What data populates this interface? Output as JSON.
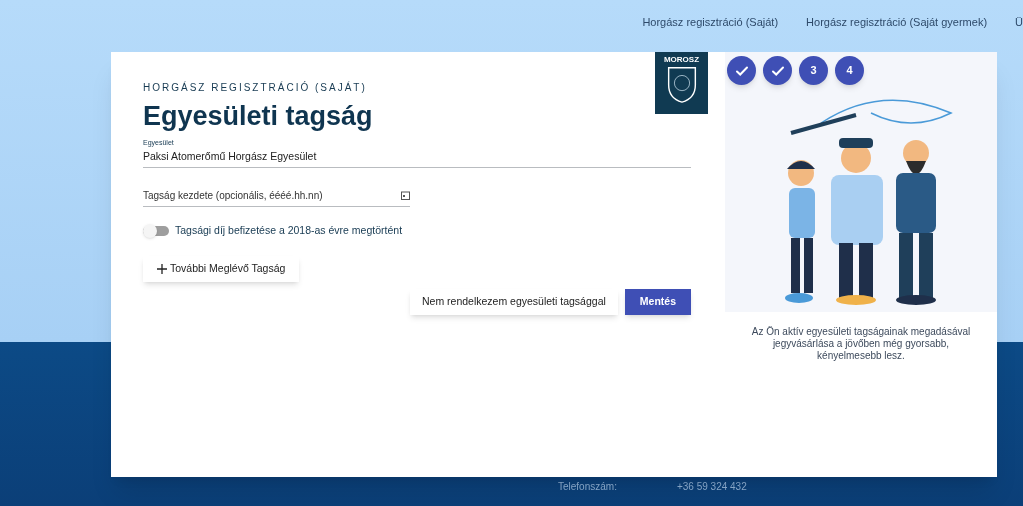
{
  "nav": {
    "items": [
      {
        "label": "Horgász regisztráció (Saját)"
      },
      {
        "label": "Horgász regisztráció (Saját gyermek)"
      },
      {
        "label": "Ü"
      }
    ]
  },
  "modal": {
    "logo": {
      "text": "MOROSZ"
    },
    "eyebrow": "HORGÁSZ REGISZTRÁCIÓ (SAJÁT)",
    "title": "Egyesületi tagság",
    "association_field": {
      "label": "Egyesület",
      "value": "Paksi Atomerőmű Horgász Egyesület"
    },
    "start_date_field": {
      "placeholder": "Tagság kezdete (opcionális, éééé.hh.nn)"
    },
    "fee_toggle": {
      "label": "Tagsági díj befizetése a 2018-as évre megtörtént",
      "on": false
    },
    "add_button": "További Meglévő Tagság",
    "secondary_button": "Nem rendelkezem egyesületi tagsággal",
    "primary_button": "Mentés",
    "steps": [
      {
        "kind": "done"
      },
      {
        "kind": "done"
      },
      {
        "kind": "number",
        "label": "3"
      },
      {
        "kind": "number",
        "label": "4"
      }
    ],
    "info_text": "Az Ön aktív egyesületi tagságainak megadásával jegyvásárlása a jövőben még gyorsabb, kényelmesebb lesz."
  },
  "footer": {
    "label": "Telefonszám:",
    "value": "+36 59 324 432"
  }
}
